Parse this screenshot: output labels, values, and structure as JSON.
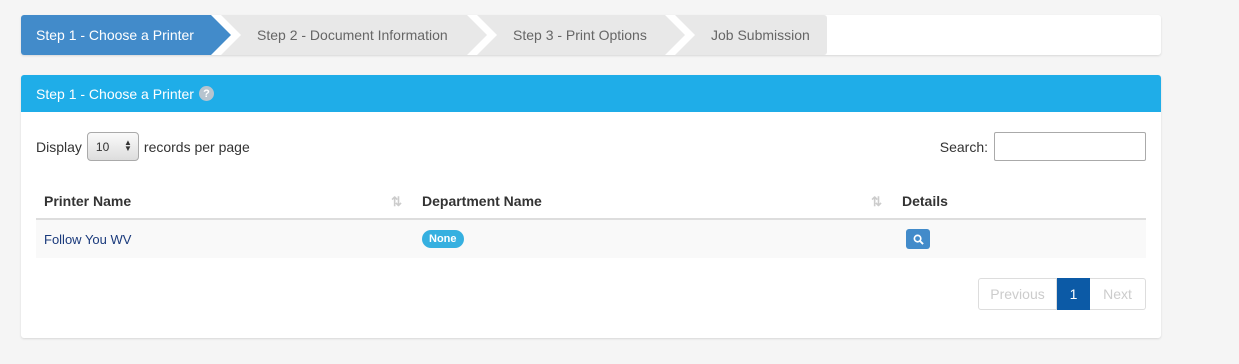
{
  "wizard": {
    "steps": [
      {
        "label": "Step 1 - Choose a Printer",
        "active": true
      },
      {
        "label": "Step 2 - Document Information",
        "active": false
      },
      {
        "label": "Step 3 - Print Options",
        "active": false
      },
      {
        "label": "Job Submission",
        "active": false
      }
    ]
  },
  "panel": {
    "title": "Step 1 - Choose a Printer",
    "help_symbol": "?"
  },
  "length": {
    "prefix": "Display",
    "value": "10",
    "suffix": "records per page"
  },
  "search": {
    "label": "Search:",
    "value": ""
  },
  "table": {
    "headers": [
      "Printer Name",
      "Department Name",
      "Details"
    ],
    "rows": [
      {
        "printer": "Follow You WV",
        "department": "None"
      }
    ]
  },
  "pagination": {
    "previous": "Previous",
    "current": "1",
    "next": "Next"
  },
  "colors": {
    "active_step": "#428bca",
    "panel_heading": "#1fade8",
    "badge": "#36b0e0",
    "page_current": "#0c5aa6"
  },
  "icons": {
    "help": "question-circle-icon",
    "sort": "sort-icon",
    "details": "search-icon"
  }
}
